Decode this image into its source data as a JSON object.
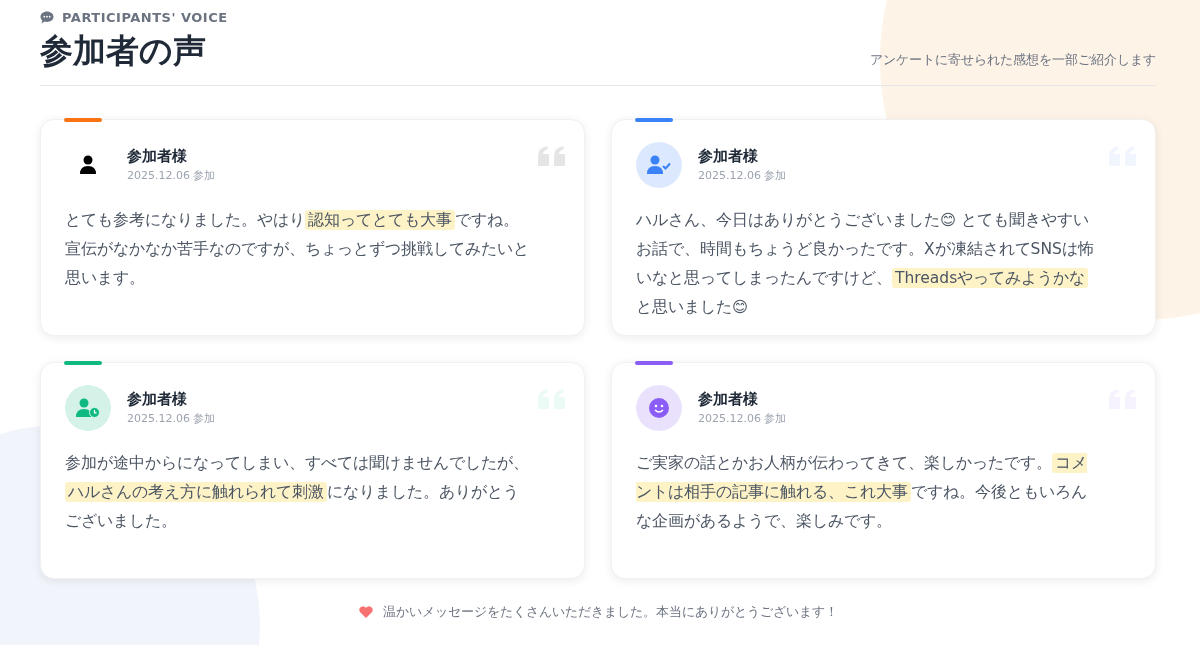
{
  "header": {
    "eyebrow": "PARTICIPANTS' VOICE",
    "title": "参加者の声",
    "subtitle": "アンケートに寄せられた感想を一部ご紹介します"
  },
  "cards": [
    {
      "color": "#f97316",
      "kind": "person",
      "name": "参加者様",
      "date": "2025.12.06 参加",
      "segments": [
        {
          "text": "とても参考になりました。やはり",
          "highlight": false
        },
        {
          "text": "認知ってとても大事",
          "highlight": true
        },
        {
          "text": "ですね。宣伝がなかなか苦手なのですが、ちょっとずつ挑戦してみたいと思います。",
          "highlight": false
        }
      ]
    },
    {
      "color": "#3b82f6",
      "kind": "person-check",
      "name": "参加者様",
      "date": "2025.12.06 参加",
      "segments": [
        {
          "text": "ハルさん、今日はありがとうございました😊 とても聞きやすいお話で、時間もちょうど良かったです。Xが凍結されてSNSは怖いなと思ってしまったんですけど、",
          "highlight": false
        },
        {
          "text": "Threadsやってみようかな",
          "highlight": true
        },
        {
          "text": "と思いました😊",
          "highlight": false
        }
      ]
    },
    {
      "color": "#10b981",
      "kind": "person-clock",
      "name": "参加者様",
      "date": "2025.12.06 参加",
      "segments": [
        {
          "text": "参加が途中からになってしまい、すべては聞けませんでしたが、",
          "highlight": false
        },
        {
          "text": "ハルさんの考え方に触れられて刺激",
          "highlight": true
        },
        {
          "text": "になりました。ありがとうございました。",
          "highlight": false
        }
      ]
    },
    {
      "color": "#8b5cf6",
      "kind": "smile",
      "name": "参加者様",
      "date": "2025.12.06 参加",
      "segments": [
        {
          "text": "ご実家の話とかお人柄が伝わってきて、楽しかったです。",
          "highlight": false
        },
        {
          "text": "コメントは相手の記事に触れる、これ大事",
          "highlight": true
        },
        {
          "text": "ですね。今後ともいろんな企画があるようで、楽しみです。",
          "highlight": false
        }
      ]
    }
  ],
  "footer": {
    "text": "温かいメッセージをたくさんいただきました。本当にありがとうございます！"
  }
}
